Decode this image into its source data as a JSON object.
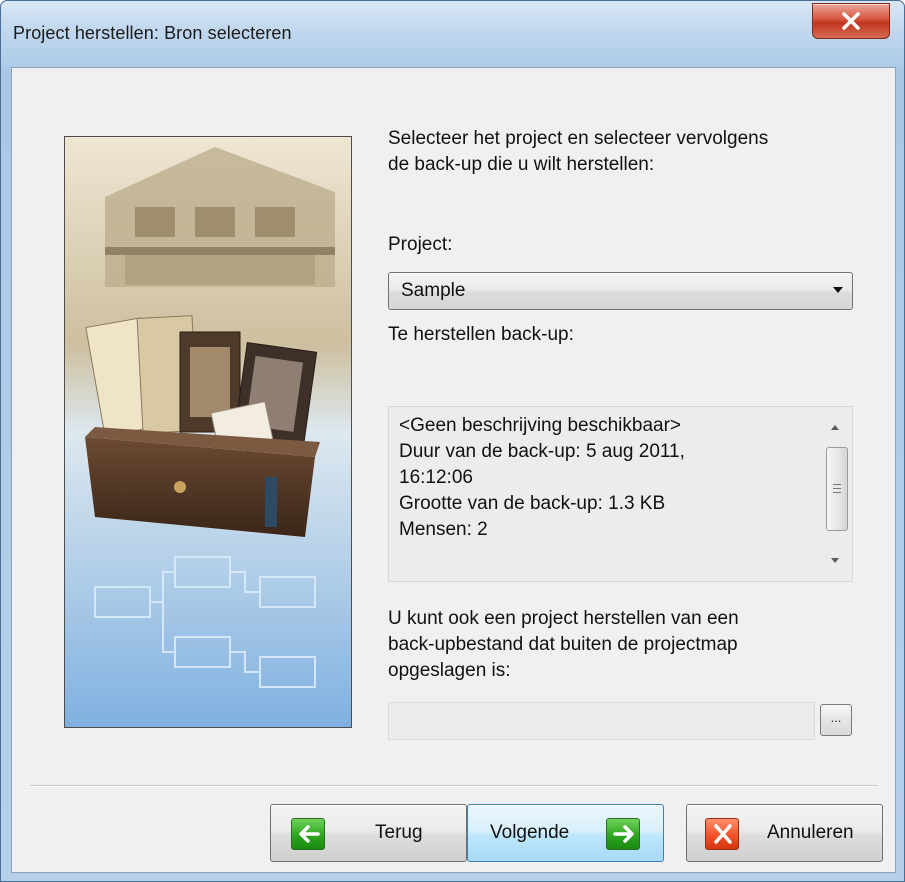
{
  "window": {
    "title": "Project herstellen: Bron selecteren",
    "close_icon": "close-icon"
  },
  "intro": {
    "text_line1": "Selecteer het project en selecteer vervolgens",
    "text_line2": "de back-up die u wilt herstellen:"
  },
  "project": {
    "label": "Project:",
    "selected": "Sample"
  },
  "backup": {
    "label": "Te herstellen back-up:",
    "lines": [
      "<Geen beschrijving beschikbaar>",
      "Duur van de back-up: 5 aug 2011,",
      "16:12:06",
      "Grootte van de back-up: 1.3 KB",
      "Mensen: 2"
    ]
  },
  "file_restore": {
    "line1": "U kunt ook een project herstellen van een",
    "line2": "back-upbestand dat buiten de projectmap",
    "line3": "opgeslagen is:",
    "path_value": "",
    "browse_label": "..."
  },
  "buttons": {
    "back": "Terug",
    "next": "Volgende",
    "cancel": "Annuleren"
  },
  "colors": {
    "accent_blue": "#3c7fb1",
    "green_icon": "#2ea51f",
    "red_icon": "#f2532b",
    "close_red": "#c0351f"
  }
}
